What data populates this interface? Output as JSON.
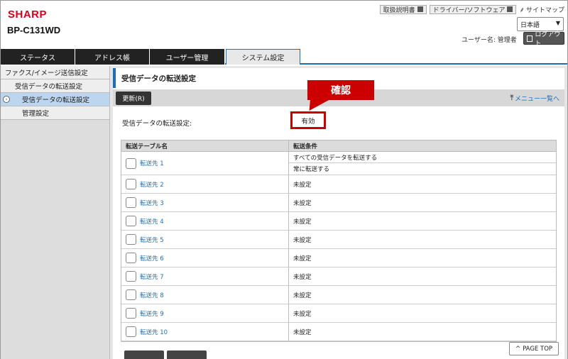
{
  "header": {
    "brand": "SHARP",
    "model": "BP-C131WD",
    "links": [
      {
        "label": "取扱説明書"
      },
      {
        "label": "ドライバー/ソフトウェア"
      }
    ],
    "sitemap": "サイトマップ",
    "language": "日本語",
    "user": "ユーザー名: 管理者",
    "logout": "ログアウト"
  },
  "tabs": [
    {
      "label": "ステータス"
    },
    {
      "label": "アドレス帳"
    },
    {
      "label": "ユーザー管理"
    },
    {
      "label": "システム設定"
    }
  ],
  "sidebar": {
    "items": [
      {
        "label": "ファクス/イメージ送信設定"
      },
      {
        "label": "受信データの転送設定"
      },
      {
        "label": "受信データの転送設定"
      },
      {
        "label": "管理設定"
      }
    ]
  },
  "main": {
    "title": "受信データの転送設定",
    "update_button": "更新(R)",
    "menu_link": "メニュー一覧へ",
    "setting_label": "受信データの転送設定:",
    "setting_value": "有効",
    "callout": "確認",
    "table": {
      "headers": [
        "転送テーブル名",
        "転送条件"
      ],
      "rows": [
        {
          "name": "転送先 1",
          "cond1": "すべての受信データを転送する",
          "cond2": "常に転送する"
        },
        {
          "name": "転送先 2",
          "cond": "未設定"
        },
        {
          "name": "転送先 3",
          "cond": "未設定"
        },
        {
          "name": "転送先 4",
          "cond": "未設定"
        },
        {
          "name": "転送先 5",
          "cond": "未設定"
        },
        {
          "name": "転送先 6",
          "cond": "未設定"
        },
        {
          "name": "転送先 7",
          "cond": "未設定"
        },
        {
          "name": "転送先 8",
          "cond": "未設定"
        },
        {
          "name": "転送先 9",
          "cond": "未設定"
        },
        {
          "name": "転送先 10",
          "cond": "未設定"
        }
      ]
    },
    "page_top": "PAGE TOP"
  }
}
